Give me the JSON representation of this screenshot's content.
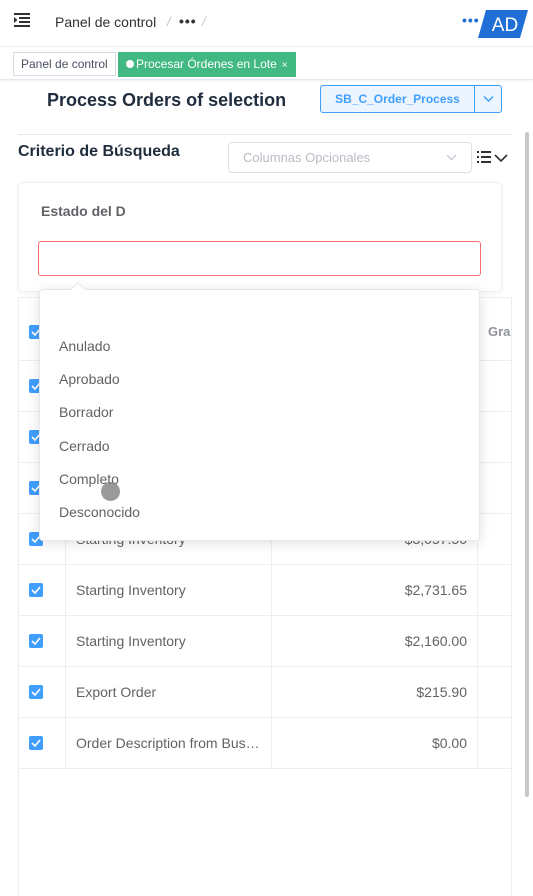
{
  "topbar": {
    "breadcrumb_home": "Panel de control",
    "separator": "/",
    "more": "•••",
    "logo_text": "AD",
    "accent": "#1f6fd6"
  },
  "tabs": [
    {
      "label": "Panel de control",
      "active": false
    },
    {
      "label": "Procesar Órdenes en Lote",
      "active": true,
      "close": "×"
    }
  ],
  "process": {
    "title": "Process Orders of selection",
    "button_label": "SB_C_Order_Process"
  },
  "criteria": {
    "title": "Criterio de Búsqueda",
    "optional_columns_placeholder": "Columnas Opcionales",
    "field_label": "Estado del D",
    "field_value": ""
  },
  "dropdown": {
    "options": [
      "Anulado",
      "Aprobado",
      "Borrador",
      "Cerrado",
      "Completo",
      "Desconocido"
    ]
  },
  "table": {
    "partial_header": "Gra",
    "rows": [
      {
        "description": "",
        "amount": "",
        "checked": true
      },
      {
        "description": "",
        "amount": "",
        "checked": true
      },
      {
        "description": "",
        "amount": "",
        "checked": true
      },
      {
        "description": "Starting Inventory",
        "amount": "$3,057.50",
        "checked": true
      },
      {
        "description": "Starting Inventory",
        "amount": "$2,731.65",
        "checked": true
      },
      {
        "description": "Starting Inventory",
        "amount": "$2,160.00",
        "checked": true
      },
      {
        "description": "Export Order",
        "amount": "$215.90",
        "checked": true
      },
      {
        "description": "Order Description from Business Partner",
        "amount": "$0.00",
        "checked": true
      }
    ]
  },
  "colors": {
    "primary": "#409eff",
    "success_tab": "#42b983",
    "error_border": "#f56c6c"
  }
}
